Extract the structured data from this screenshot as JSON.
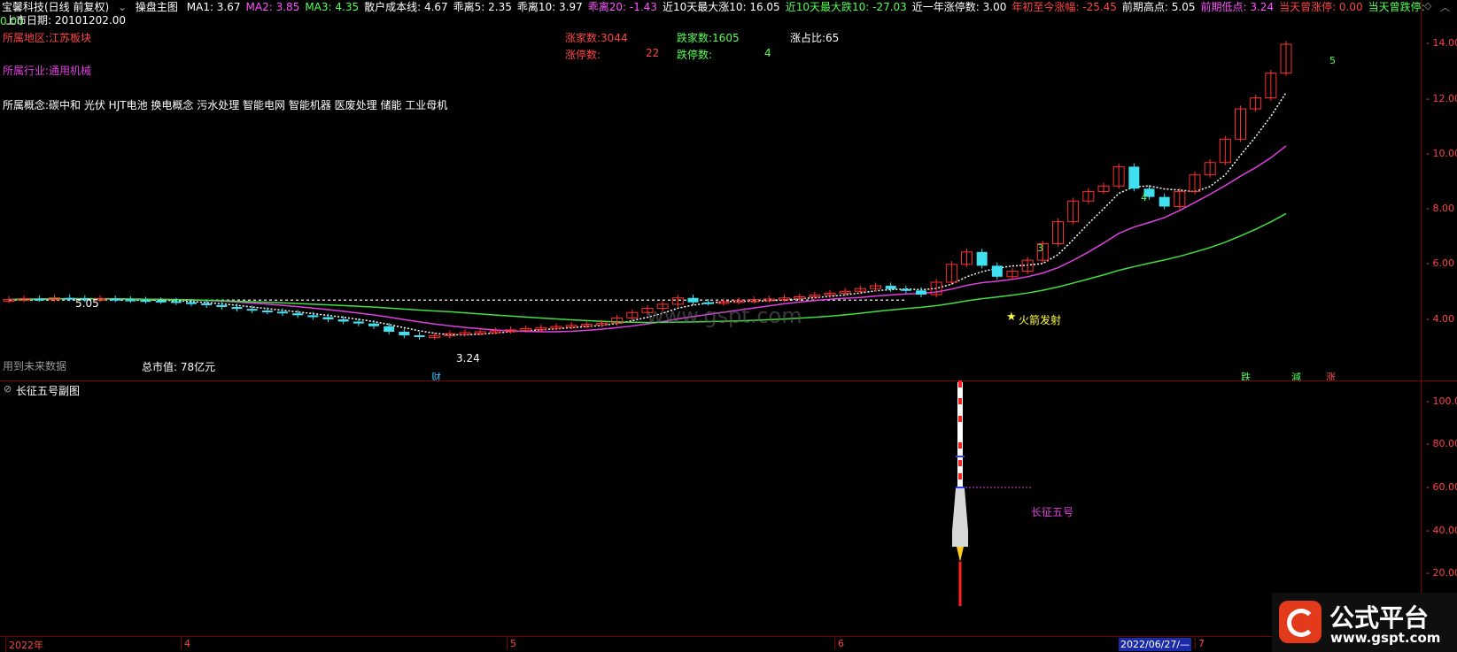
{
  "header": {
    "stock_name": "宝馨科技(日线 前复权)",
    "indicator_name": "操盘主图",
    "stats": [
      {
        "label": "MA1: 3.67",
        "color": "#ffffff"
      },
      {
        "label": "MA2: 3.85",
        "color": "#ff55ff"
      },
      {
        "label": "MA3: 4.35",
        "color": "#55ff55"
      },
      {
        "label": "散户成本线: 4.67",
        "color": "#ffffff"
      },
      {
        "label": "乖离5: 2.35",
        "color": "#ffffff"
      },
      {
        "label": "乖离10: 3.97",
        "color": "#ffffff"
      },
      {
        "label": "乖离20: -1.43",
        "color": "#ff55ff"
      },
      {
        "label": "近10天最大涨10: 16.05",
        "color": "#ffffff"
      },
      {
        "label": "近10天最大跌10: -27.03",
        "color": "#55ff55"
      },
      {
        "label": "近一年涨停数: 3.00",
        "color": "#ffffff"
      },
      {
        "label": "年初至今涨幅: -25.45",
        "color": "#ff4444"
      },
      {
        "label": "前期高点: 5.05",
        "color": "#ffffff"
      },
      {
        "label": "前期低点: 3.24",
        "color": "#ff55ff"
      },
      {
        "label": "当天曾涨停: 0.00",
        "color": "#ff4444"
      },
      {
        "label": "当天曾跌停: 0.00",
        "color": "#55ff55"
      }
    ],
    "listing_date": "上市日期: 20101202.00"
  },
  "info": {
    "region": "所属地区:江苏板块",
    "industry": "所属行业:通用机械",
    "concepts": "所属概念:碳中和 光伏 HJT电池 换电概念 污水处理 智能电网 智能机器 医废处理 储能 工业母机",
    "future_data_note": "用到未来数据",
    "market_cap": "总市值: 78亿元"
  },
  "market": {
    "up_count": "涨家数:3044",
    "down_count": "跌家数:1605",
    "up_ratio": "涨占比:65",
    "limit_up_label": "涨停数:",
    "limit_up_value": "22",
    "limit_down_label": "跌停数:",
    "limit_down_value": "4"
  },
  "annotations": {
    "prev_high": "5.05",
    "prev_low": "3.24",
    "finance_marker": "财",
    "rocket_launch": "火箭发射",
    "count3": "3",
    "count4": "4",
    "count5": "5",
    "sig_die": "跌",
    "sig_jian": "減",
    "sig_zhang": "涨",
    "watermark_mid": "www.gspt.com"
  },
  "price_axis": [
    "14.00",
    "12.00",
    "10.00",
    "8.00",
    "6.00",
    "4.00"
  ],
  "sub_panel": {
    "title": "长征五号副图",
    "label": "长征五号",
    "axis": [
      "100.0",
      "80.00",
      "60.00",
      "40.00",
      "20.00"
    ]
  },
  "time_axis": {
    "labels": [
      "2022年",
      "4",
      "5",
      "6",
      "7"
    ],
    "cursor_date": "2022/06/27/—"
  },
  "logo": {
    "text": "公式平台",
    "url": "www.gspt.com"
  },
  "colors": {
    "up": "#ff3030",
    "down": "#40e0f0",
    "ma_slow": "#40e040",
    "ma_mid": "#e040e0"
  }
}
